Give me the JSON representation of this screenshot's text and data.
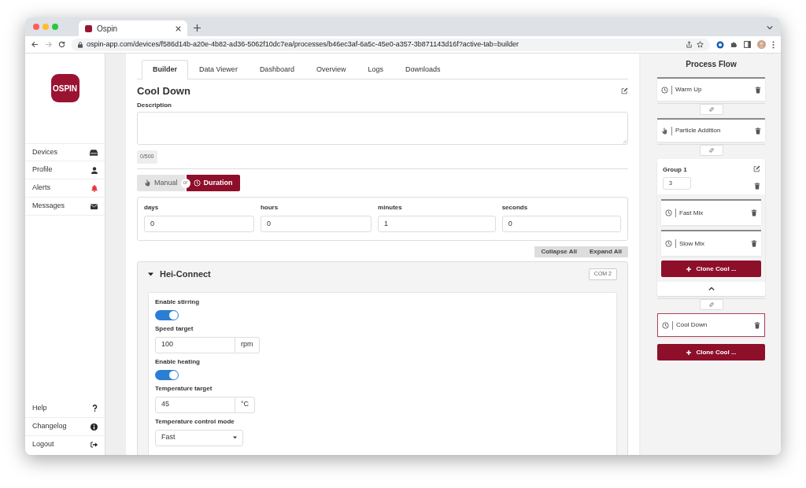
{
  "browser": {
    "tab_title": "Ospin",
    "url": "ospin-app.com/devices/f586d14b-a20e-4b82-ad36-5062f10dc7ea/processes/b46ec3af-6a5c-45e0-a357-3b871143d16f?active-tab=builder"
  },
  "sidebar": {
    "logo": "OSPIN",
    "items": [
      {
        "label": "Devices",
        "color": "#333333"
      },
      {
        "label": "Profile",
        "color": "#333333"
      },
      {
        "label": "Alerts",
        "color": "#e8383d"
      },
      {
        "label": "Messages",
        "color": "#333333"
      }
    ],
    "footer_items": [
      {
        "label": "Help"
      },
      {
        "label": "Changelog"
      },
      {
        "label": "Logout"
      }
    ]
  },
  "tabs": [
    {
      "label": "Builder",
      "selected": true
    },
    {
      "label": "Data Viewer",
      "selected": false
    },
    {
      "label": "Dashboard",
      "selected": false
    },
    {
      "label": "Overview",
      "selected": false
    },
    {
      "label": "Logs",
      "selected": false
    },
    {
      "label": "Downloads",
      "selected": false
    }
  ],
  "phase": {
    "title": "Cool Down",
    "description_label": "Description",
    "char_count": "0/500",
    "or_label": "or",
    "trigger_options": [
      {
        "label": "Manual",
        "kind": "manual",
        "selected": false
      },
      {
        "label": "Duration",
        "kind": "duration",
        "selected": true
      }
    ],
    "duration": [
      {
        "label": "days",
        "value": "0"
      },
      {
        "label": "hours",
        "value": "0"
      },
      {
        "label": "minutes",
        "value": "1"
      },
      {
        "label": "seconds",
        "value": "0"
      }
    ]
  },
  "actions": [
    "Collapse All",
    "Expand All"
  ],
  "device": {
    "name": "Hei-Connect",
    "expanded": true,
    "port": "COM 2",
    "fields": [
      {
        "kind": "toggle",
        "label": "Enable stirring",
        "on": true
      },
      {
        "kind": "number",
        "label": "Speed target",
        "value": "100",
        "unit": "rpm"
      },
      {
        "kind": "toggle",
        "label": "Enable heating",
        "on": true
      },
      {
        "kind": "number",
        "label": "Temperature target",
        "value": "45",
        "unit": "°C"
      },
      {
        "kind": "select",
        "label": "Temperature control mode",
        "value": "Fast"
      }
    ]
  },
  "process_flow": {
    "title": "Process Flow",
    "clone_label": "Clone Cool ...",
    "items": [
      {
        "kind": "phase",
        "label": "Warm Up",
        "manual": false,
        "selected": false
      },
      {
        "kind": "link"
      },
      {
        "kind": "phase",
        "label": "Particle Addition",
        "manual": true,
        "selected": false
      },
      {
        "kind": "link"
      },
      {
        "kind": "group",
        "title": "Group 1",
        "iterations": "3",
        "clone_label": "Clone Cool ...",
        "expanded": true,
        "children": [
          {
            "kind": "phase",
            "label": "Fast Mix",
            "manual": false,
            "selected": false
          },
          {
            "kind": "phase",
            "label": "Slow Mix",
            "manual": false,
            "selected": false
          }
        ]
      },
      {
        "kind": "link"
      },
      {
        "kind": "phase",
        "label": "Cool Down",
        "manual": false,
        "selected": true
      }
    ]
  }
}
